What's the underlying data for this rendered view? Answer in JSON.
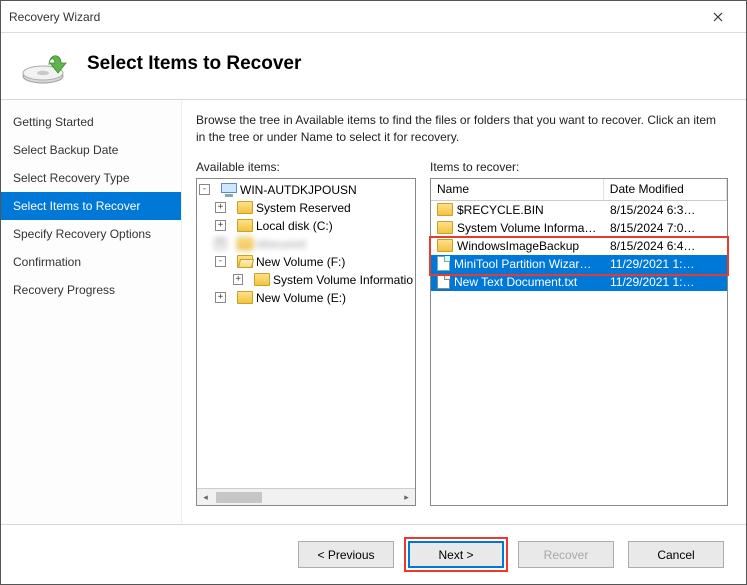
{
  "window": {
    "title": "Recovery Wizard"
  },
  "header": {
    "title": "Select Items to Recover"
  },
  "sidebar": {
    "items": [
      {
        "label": "Getting Started",
        "active": false
      },
      {
        "label": "Select Backup Date",
        "active": false
      },
      {
        "label": "Select Recovery Type",
        "active": false
      },
      {
        "label": "Select Items to Recover",
        "active": true
      },
      {
        "label": "Specify Recovery Options",
        "active": false
      },
      {
        "label": "Confirmation",
        "active": false
      },
      {
        "label": "Recovery Progress",
        "active": false
      }
    ]
  },
  "main": {
    "intro": "Browse the tree in Available items to find the files or folders that you want to recover. Click an item in the tree or under Name to select it for recovery.",
    "left_label": "Available items:",
    "right_label": "Items to recover:"
  },
  "tree": {
    "root": {
      "label": "WIN-AUTDKJPOUSN"
    },
    "nodes": [
      {
        "indent": 1,
        "expand": "+",
        "label": "System Reserved"
      },
      {
        "indent": 1,
        "expand": "+",
        "label": "Local disk (C:)"
      },
      {
        "indent": 1,
        "expand": "+",
        "label": "obscured",
        "blur": true
      },
      {
        "indent": 1,
        "expand": "-",
        "label": "New Volume (F:)"
      },
      {
        "indent": 2,
        "expand": "+",
        "label": "System Volume Informatio"
      },
      {
        "indent": 1,
        "expand": "+",
        "label": "New Volume (E:)"
      }
    ]
  },
  "table": {
    "columns": {
      "name": "Name",
      "date": "Date Modified"
    },
    "rows": [
      {
        "icon": "folder",
        "name": "$RECYCLE.BIN",
        "date": "8/15/2024 6:3…",
        "selected": false
      },
      {
        "icon": "folder",
        "name": "System Volume Informa…",
        "date": "8/15/2024 7:0…",
        "selected": false
      },
      {
        "icon": "folder",
        "name": "WindowsImageBackup",
        "date": "8/15/2024 6:4…",
        "selected": false
      },
      {
        "icon": "file",
        "name": "MiniTool Partition Wizar…",
        "date": "11/29/2021 1:…",
        "selected": true
      },
      {
        "icon": "txt",
        "name": "New Text Document.txt",
        "date": "11/29/2021 1:…",
        "selected": true
      }
    ]
  },
  "footer": {
    "previous": "< Previous",
    "next": "Next >",
    "recover": "Recover",
    "cancel": "Cancel"
  }
}
